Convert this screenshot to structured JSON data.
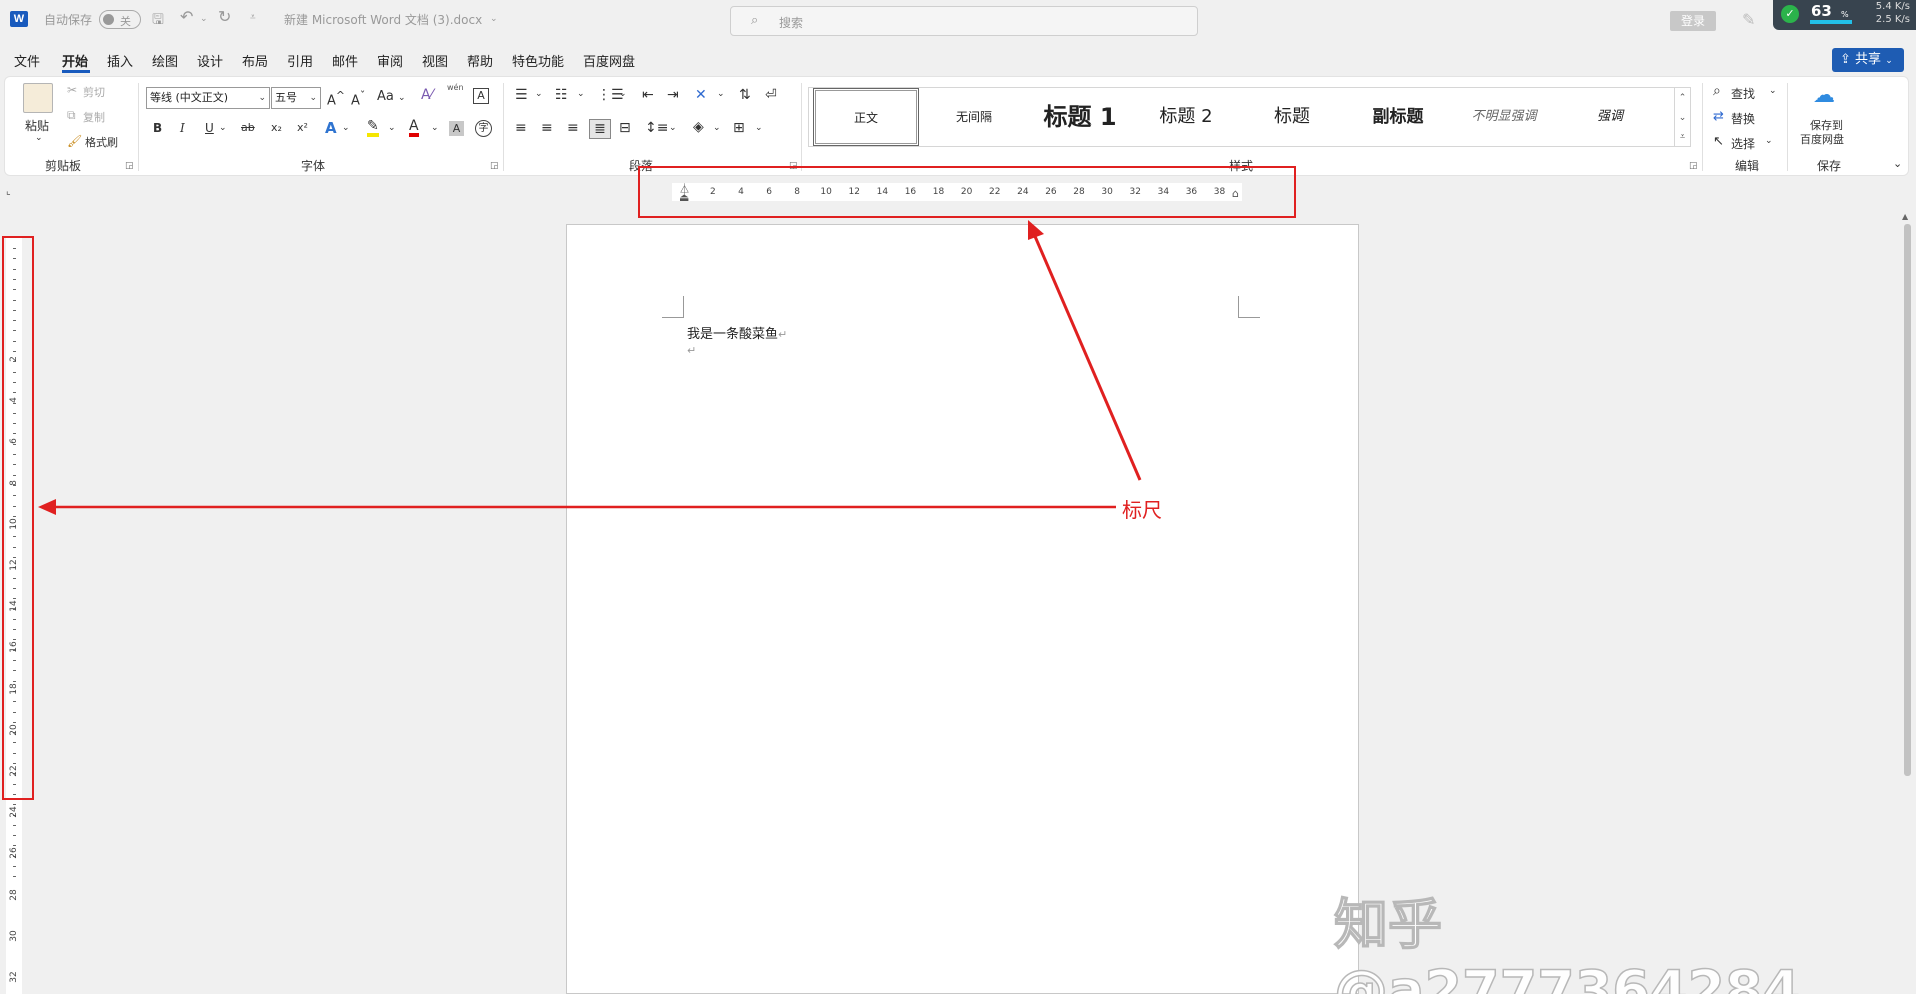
{
  "titlebar": {
    "app_logo": "W",
    "autosave_label": "自动保存",
    "autosave_state": "关",
    "doc_title": "新建 Microsoft Word 文档 (3).docx",
    "search_placeholder": "搜索",
    "login_label": "登录",
    "net_widget": {
      "percent": "63",
      "percent_sign": "%",
      "upload": "5.4 K/s",
      "download": "2.5 K/s"
    }
  },
  "menubar": {
    "items": [
      "文件",
      "开始",
      "插入",
      "绘图",
      "设计",
      "布局",
      "引用",
      "邮件",
      "审阅",
      "视图",
      "帮助",
      "特色功能",
      "百度网盘"
    ],
    "active": "开始",
    "share_label": "共享"
  },
  "ribbon": {
    "clipboard": {
      "paste": "粘贴",
      "cut": "剪切",
      "copy": "复制",
      "format_painter": "格式刷",
      "group": "剪贴板"
    },
    "font": {
      "font_name": "等线 (中文正文)",
      "font_size": "五号",
      "grow": "A^",
      "shrink": "A˅",
      "change_case": "Aa",
      "group": "字体",
      "bold": "B",
      "italic": "I",
      "underline": "U",
      "strike": "ab",
      "subscript": "x₂",
      "superscript": "x²",
      "pinyin": "wén"
    },
    "paragraph": {
      "group": "段落"
    },
    "styles": {
      "group": "样式",
      "items": [
        "正文",
        "无间隔",
        "标题 1",
        "标题 2",
        "标题",
        "副标题",
        "不明显强调",
        "强调"
      ]
    },
    "editing": {
      "find": "查找",
      "replace": "替换",
      "select": "选择",
      "group": "编辑"
    },
    "save": {
      "line1": "保存到",
      "line2": "百度网盘",
      "group": "保存"
    }
  },
  "ruler": {
    "horizontal": [
      "2",
      "4",
      "6",
      "8",
      "10",
      "12",
      "14",
      "16",
      "18",
      "20",
      "22",
      "24",
      "26",
      "28",
      "30",
      "32",
      "34",
      "36",
      "38"
    ],
    "vertical": [
      "2",
      "4",
      "6",
      "8",
      "10",
      "12",
      "14",
      "16",
      "18",
      "20",
      "22",
      "24",
      "26",
      "28",
      "30",
      "32"
    ]
  },
  "document": {
    "line1": "我是一条酸菜鱼",
    "para_mark": "↵"
  },
  "annotation": {
    "label": "标尺",
    "color": "#e02020"
  },
  "watermark": "知乎 @a2777364284"
}
